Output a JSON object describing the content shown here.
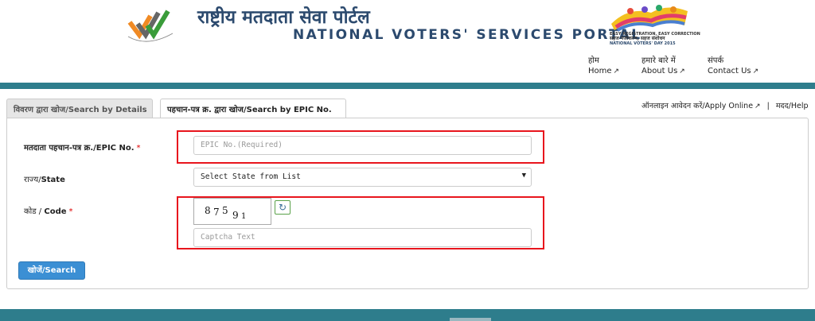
{
  "header": {
    "title_hindi": "राष्ट्रीय मतदाता सेवा पोर्टल",
    "title_english": "NATIONAL VOTERS' SERVICES PORTAL",
    "nvd_line1": "EASY REGISTRATION, EASY CORRECTION",
    "nvd_line2": "सहज पंजीकरण, सहज संशोधन",
    "nvd_line3": "NATIONAL VOTERS' DAY 2015",
    "nav": [
      {
        "hindi": "होम",
        "english": "Home"
      },
      {
        "hindi": "हमारे बारे में",
        "english": "About Us"
      },
      {
        "hindi": "संपर्क",
        "english": "Contact Us"
      }
    ],
    "external_icon": "external-link-icon"
  },
  "tabs": [
    {
      "label": "विवरण द्वारा खोज/Search by Details",
      "active": false
    },
    {
      "label": "पहचान-पत्र क्र. द्वारा खोज/Search by EPIC No.",
      "active": true
    }
  ],
  "top_links": {
    "apply_online": "ऑनलाइन आवेदन करें/Apply Online",
    "separator": "|",
    "help": "मदद/Help"
  },
  "form": {
    "epic_label": "मतदाता पहचान-पत्र क्र./EPIC No.",
    "epic_placeholder": "EPIC No.(Required)",
    "state_label_hi": "राज्य/",
    "state_label_en": "State",
    "state_selected": "Select State from List",
    "code_label_hi": "कोड / ",
    "code_label_en": "Code",
    "required_mark": "*",
    "captcha_digits": [
      "8",
      "7",
      "5",
      "9",
      "1"
    ],
    "captcha_placeholder": "Captcha Text",
    "refresh_icon": "refresh-icon",
    "search_button": "खोजें/Search"
  },
  "colors": {
    "brand_teal": "#2e7d8c",
    "button_blue": "#3b8fd4",
    "highlight_red": "#e8151d",
    "title_navy": "#2c4a6e"
  }
}
